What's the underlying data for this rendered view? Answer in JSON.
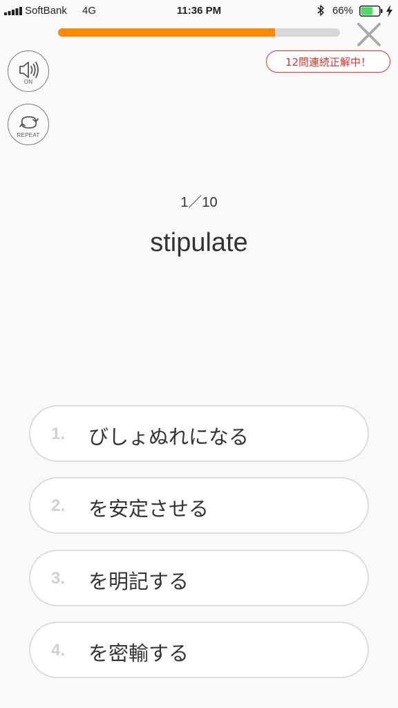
{
  "status_bar": {
    "carrier": "SoftBank",
    "network": "4G",
    "time": "11:36 PM",
    "battery_percent": "66%",
    "battery_level": 0.66,
    "icons": [
      "signal-icon",
      "bluetooth-icon",
      "battery-icon",
      "charging-icon"
    ]
  },
  "quiz": {
    "progress": 0.77,
    "streak_badge": "12問連続正解中！",
    "counter": "1／10",
    "word": "stipulate"
  },
  "controls": {
    "sound_label": "ON",
    "repeat_label": "REPEAT"
  },
  "choices": [
    {
      "number": "1.",
      "text": "びしょぬれになる"
    },
    {
      "number": "2.",
      "text": "を安定させる"
    },
    {
      "number": "3.",
      "text": "を明記する"
    },
    {
      "number": "4.",
      "text": "を密輸する"
    }
  ],
  "colors": {
    "accent": "#ff8a00",
    "streak_red": "#e4322b",
    "battery_green": "#4cd964"
  }
}
